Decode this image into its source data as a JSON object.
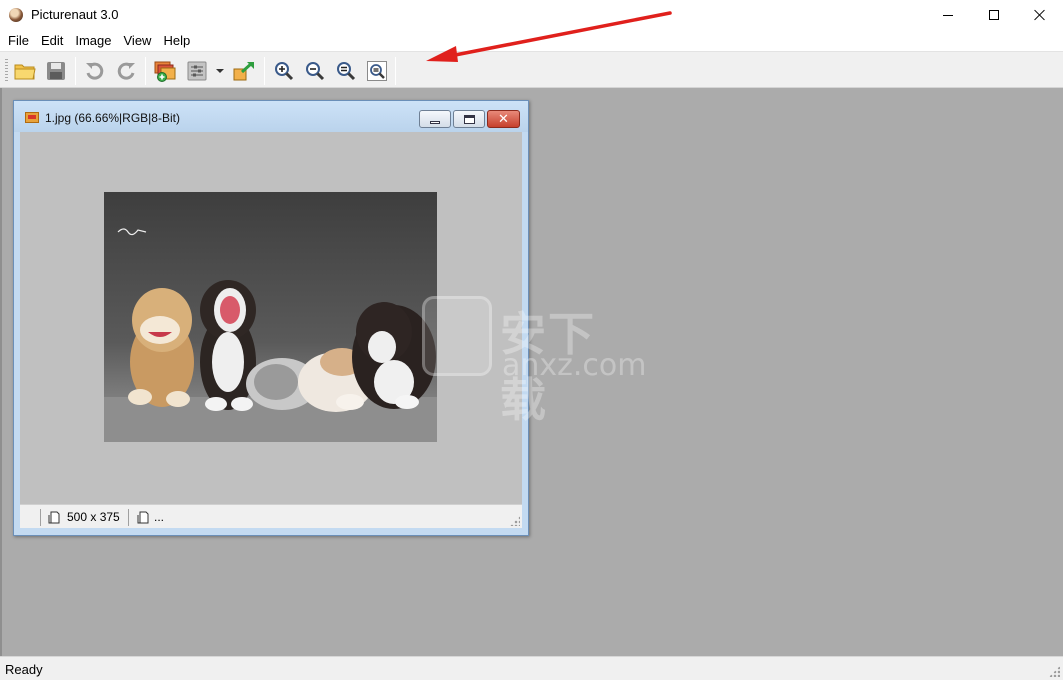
{
  "app": {
    "title": "Picturenaut 3.0"
  },
  "window_controls": {
    "minimize": "minimize-icon",
    "maximize": "maximize-icon",
    "close": "close-icon"
  },
  "menu": [
    "File",
    "Edit",
    "Image",
    "View",
    "Help"
  ],
  "toolbar": {
    "icons": [
      "open-folder-icon",
      "save-icon",
      "undo-icon",
      "redo-icon",
      "hdr-generate-icon",
      "tone-mapping-icon",
      "dropdown-arrow-icon",
      "export-icon",
      "zoom-in-icon",
      "zoom-out-icon",
      "zoom-actual-icon",
      "zoom-fit-icon"
    ]
  },
  "document": {
    "title": "1.jpg (66.66%|RGB|8-Bit)",
    "dimensions": "500 x 375",
    "secondary_status": "..."
  },
  "watermark": {
    "chinese": "安下载",
    "domain": "anxz.com"
  },
  "statusbar": {
    "text": "Ready"
  },
  "colors": {
    "workspace": "#ababab",
    "annotation_arrow": "#e0201c",
    "child_frame": "#c3daf1"
  }
}
